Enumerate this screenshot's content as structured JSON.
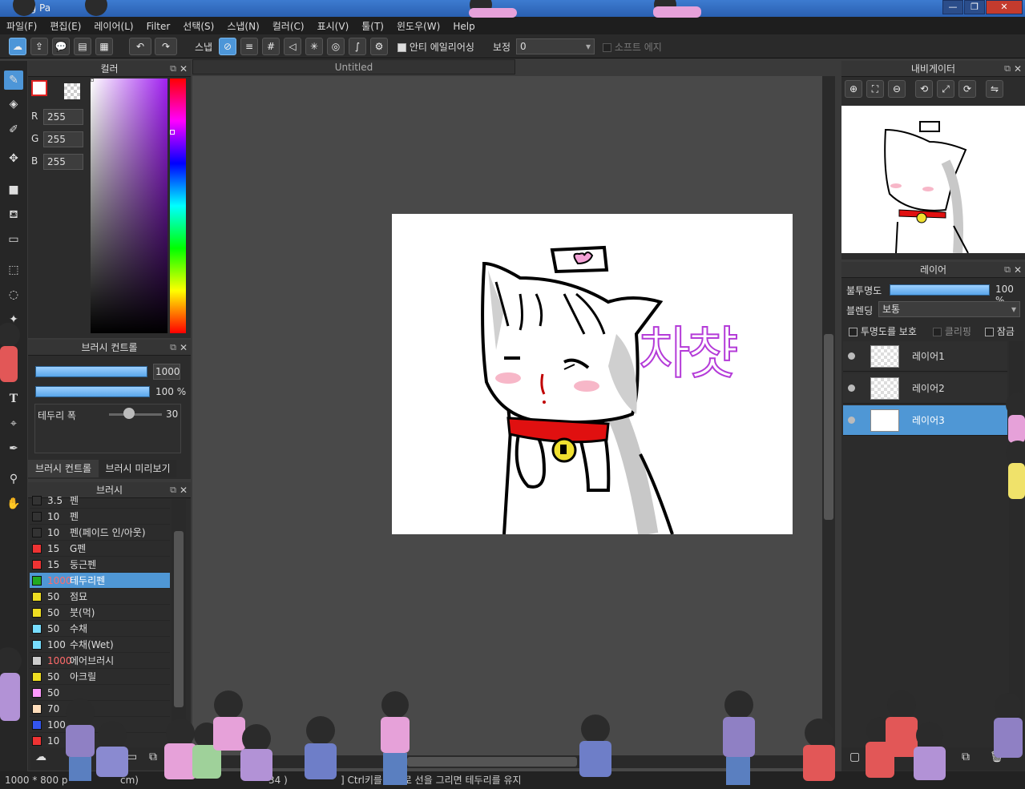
{
  "window": {
    "title": "ng Pa",
    "min": "—",
    "max": "❐",
    "close": "✕"
  },
  "menu": [
    "파일(F)",
    "편집(E)",
    "레이어(L)",
    "Filter",
    "선택(S)",
    "스냅(N)",
    "컬러(C)",
    "표시(V)",
    "툴(T)",
    "윈도우(W)",
    "Help"
  ],
  "toolbar": {
    "snap_label": "스냅",
    "antialias_label": "안티 에일리어싱",
    "correction_label": "보정",
    "correction_value": "0",
    "soft_edge_label": "소프트 에지"
  },
  "document": {
    "tab": "Untitled",
    "handwriting": "차챳"
  },
  "color_panel": {
    "title": "컬러",
    "r_label": "R",
    "g_label": "G",
    "b_label": "B",
    "r": "255",
    "g": "255",
    "b": "255"
  },
  "brush_control": {
    "title": "브러시 컨트롤",
    "size": "1000",
    "opacity": "100 %",
    "border_label": "테두리 폭",
    "border_value": "30",
    "tab1": "브러시 컨트롤",
    "tab2": "브러시 미리보기"
  },
  "brush_panel": {
    "title": "브러시",
    "items": [
      {
        "size": "3.5",
        "name": "펜",
        "color": "#333333"
      },
      {
        "size": "10",
        "name": "펜",
        "color": "#333333"
      },
      {
        "size": "10",
        "name": "펜(페이드 인/아웃)",
        "color": "#333333"
      },
      {
        "size": "15",
        "name": "G펜",
        "color": "#ee3333"
      },
      {
        "size": "15",
        "name": "둥근펜",
        "color": "#ee3333"
      },
      {
        "size": "1000",
        "name": "테두리펜",
        "color": "#22aa22"
      },
      {
        "size": "50",
        "name": "점묘",
        "color": "#eedd22"
      },
      {
        "size": "50",
        "name": "붓(먹)",
        "color": "#eedd22"
      },
      {
        "size": "50",
        "name": "수채",
        "color": "#77ddff"
      },
      {
        "size": "100",
        "name": "수채(Wet)",
        "color": "#77ddff"
      },
      {
        "size": "1000",
        "name": "에어브러시",
        "color": "#cccccc"
      },
      {
        "size": "50",
        "name": "아크릴",
        "color": "#eedd22"
      },
      {
        "size": "50",
        "name": "",
        "color": "#ff99ff"
      },
      {
        "size": "70",
        "name": "",
        "color": "#ffddbb"
      },
      {
        "size": "100",
        "name": "",
        "color": "#3355ee"
      },
      {
        "size": "10",
        "name": "",
        "color": "#ee3333"
      }
    ]
  },
  "navigator": {
    "title": "내비게이터"
  },
  "layers": {
    "title": "레이어",
    "opacity_label": "불투명도",
    "opacity_value": "100 %",
    "blend_label": "블렌딩",
    "blend_value": "보통",
    "protect_label": "투명도를 보호",
    "clipping_label": "클리핑",
    "lock_label": "잠금",
    "items": [
      {
        "name": "레이어1"
      },
      {
        "name": "레이어2"
      },
      {
        "name": "레이어3"
      }
    ]
  },
  "status": {
    "size": "1000 * 800 p",
    "unit": "cm)",
    "coord": "34 )",
    "hint": "] Ctrl키를    상태로 선을 그리면 테두리를 유지"
  }
}
